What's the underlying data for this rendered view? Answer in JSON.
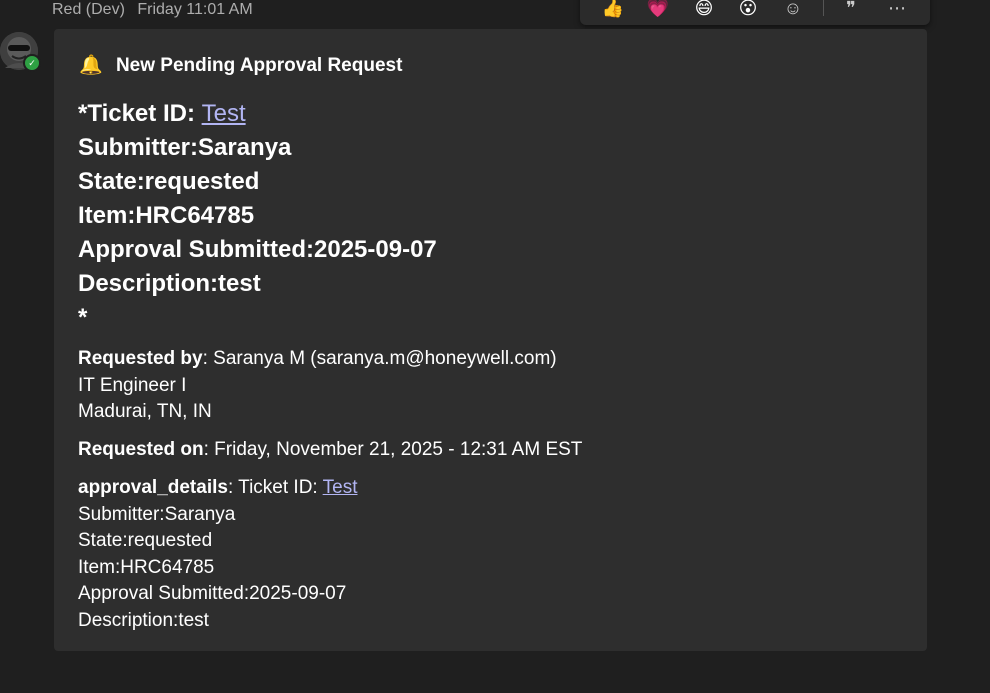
{
  "message": {
    "sender": "Red (Dev)",
    "time": "Friday 11:01 AM"
  },
  "reactions": [
    {
      "icon": "thumbs-up-icon",
      "glyph": "👍"
    },
    {
      "icon": "heart-icon",
      "glyph": "💗"
    },
    {
      "icon": "laugh-icon",
      "glyph": "😄"
    },
    {
      "icon": "surprised-icon",
      "glyph": "😮"
    },
    {
      "icon": "add-reaction-icon",
      "glyph": "☺"
    },
    {
      "icon": "quote-icon",
      "glyph": "❞"
    },
    {
      "icon": "more-options-icon",
      "glyph": "⋯"
    }
  ],
  "card": {
    "title": "New Pending Approval Request",
    "bell": "🔔",
    "ticket_label": "*Ticket ID: ",
    "ticket_link": "Test",
    "submitter": "Submitter:Saranya",
    "state": "State:requested",
    "item": "Item:HRC64785",
    "approval_submitted": "Approval Submitted:2025-09-07",
    "description": "Description:test",
    "asterisk": "*",
    "requested_by_label": "Requested by",
    "requested_by_value": ": Saranya M (saranya.m@honeywell.com)",
    "role": "IT Engineer I",
    "location": "Madurai, TN, IN",
    "requested_on_label": "Requested on",
    "requested_on_value": ": Friday, November 21, 2025 - 12:31 AM EST",
    "approval_details_label": "approval_details",
    "approval_details_prefix": ": Ticket ID: ",
    "approval_details_link": "Test",
    "details_submitter": "Submitter:Saranya",
    "details_state": "State:requested",
    "details_item": "Item:HRC64785",
    "details_approval_submitted": "Approval Submitted:2025-09-07",
    "details_description": "Description:test"
  },
  "colors": {
    "background": "#1f1f1f",
    "card": "#2e2e2e",
    "link": "#b2b5f3",
    "presence": "#2ea043"
  }
}
